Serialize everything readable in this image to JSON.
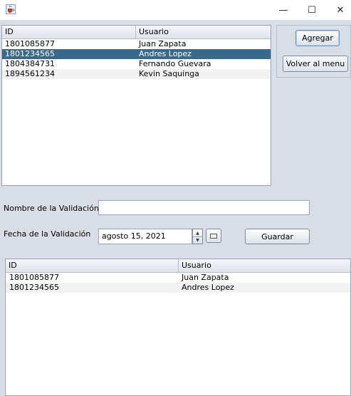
{
  "window": {
    "minimize_glyph": "—",
    "maximize_glyph": "☐",
    "close_glyph": "✕"
  },
  "users_table": {
    "columns": [
      "ID",
      "Usuario"
    ],
    "rows": [
      {
        "id": "1801085877",
        "usuario": "Juan Zapata"
      },
      {
        "id": "1801234565",
        "usuario": "Andres Lopez"
      },
      {
        "id": "1804384731",
        "usuario": "Fernando Guevara"
      },
      {
        "id": "1894561234",
        "usuario": "Kevin Saquinga"
      }
    ],
    "selected_row": 1
  },
  "buttons": {
    "agregar": "Agregar",
    "volver": "Volver al menu",
    "guardar": "Guardar"
  },
  "form": {
    "nombre_label": "Nombre de la Validación",
    "nombre_value": "",
    "fecha_label": "Fecha de la Validación",
    "fecha_value": "agosto 15, 2021"
  },
  "validation_table": {
    "columns": [
      "ID",
      "Usuario"
    ],
    "rows": [
      {
        "id": "1801085877",
        "usuario": "Juan Zapata"
      },
      {
        "id": "1801234565",
        "usuario": "Andres Lopez"
      }
    ]
  },
  "colors": {
    "background": "#d9dde6",
    "selection": "#39698a"
  },
  "icons": {
    "app": "java-coffee-cup-icon",
    "calendar": "calendar-icon"
  }
}
